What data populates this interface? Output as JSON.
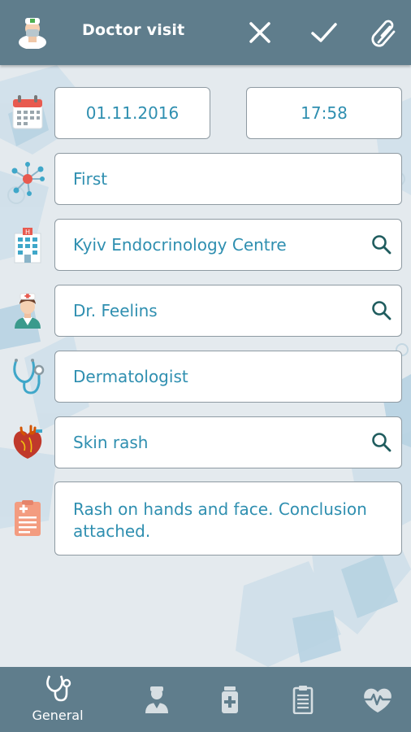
{
  "header": {
    "title": "Doctor visit",
    "avatar_icon": "doctor-avatar-icon",
    "actions": [
      {
        "name": "close-button",
        "icon": "close-icon"
      },
      {
        "name": "confirm-button",
        "icon": "checkmark-icon"
      },
      {
        "name": "attach-button",
        "icon": "paperclip-icon"
      }
    ]
  },
  "form": {
    "date": "01.11.2016",
    "time": "17:58",
    "visit_type": "First",
    "clinic": "Kyiv Endocrinology Centre",
    "doctor": "Dr. Feelins",
    "specialty": "Dermatologist",
    "diagnosis": "Skin rash",
    "notes": "Rash on hands and face. Conclusion attached."
  },
  "row_icons": [
    "calendar-icon",
    "molecule-icon",
    "hospital-icon",
    "nurse-icon",
    "stethoscope-icon",
    "heart-icon",
    "medical-report-icon"
  ],
  "bottom_nav": {
    "tabs": [
      {
        "label": "General",
        "icon": "stethoscope-icon",
        "active": true
      },
      {
        "label": "",
        "icon": "doctor-icon"
      },
      {
        "label": "",
        "icon": "medicine-bottle-icon"
      },
      {
        "label": "",
        "icon": "clipboard-icon"
      },
      {
        "label": "",
        "icon": "heart-pulse-icon"
      }
    ]
  },
  "colors": {
    "bar": "#5f7d8c",
    "field_text": "#2f8fb0",
    "background": "#e4eaee"
  }
}
